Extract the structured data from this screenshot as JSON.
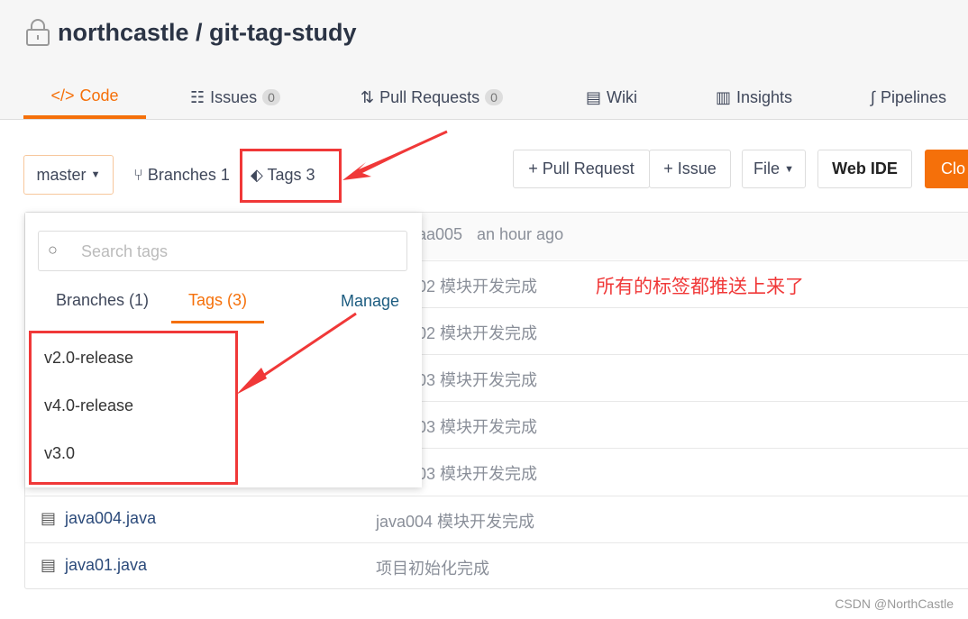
{
  "repo": {
    "title": "northcastle / git-tag-study"
  },
  "tabs": [
    {
      "label": "Code"
    },
    {
      "label": "Issues",
      "count": "0"
    },
    {
      "label": "Pull Requests",
      "count": "0"
    },
    {
      "label": "Wiki"
    },
    {
      "label": "Insights"
    },
    {
      "label": "Pipelines"
    }
  ],
  "toolbar": {
    "branch": "master",
    "branches": "Branches 1",
    "tags": "Tags 3",
    "pull_request": "+ Pull Request",
    "issue": "+ Issue",
    "file": "File",
    "web_ide": "Web IDE",
    "clone": "Clo"
  },
  "commit_header": {
    "author": "aa005",
    "time": "an hour ago"
  },
  "rows": [
    {
      "file": "",
      "message": "02 模块开发完成"
    },
    {
      "file": "",
      "message": "02 模块开发完成"
    },
    {
      "file": "",
      "message": "03 模块开发完成"
    },
    {
      "file": "",
      "message": "03 模块开发完成"
    },
    {
      "file": "",
      "message": "03 模块开发完成"
    },
    {
      "file": "java004.java",
      "message": "java004 模块开发完成"
    },
    {
      "file": "java01.java",
      "message": "项目初始化完成"
    }
  ],
  "dropdown": {
    "search_placeholder": "Search tags",
    "tab_branches": "Branches (1)",
    "tab_tags": "Tags (3)",
    "manage": "Manage",
    "tags": [
      "v2.0-release",
      "v4.0-release",
      "v3.0"
    ]
  },
  "annotation": "所有的标签都推送上来了",
  "watermark": "CSDN @NorthCastle",
  "colors": {
    "accent": "#f5700a",
    "annotation": "#f03838"
  }
}
